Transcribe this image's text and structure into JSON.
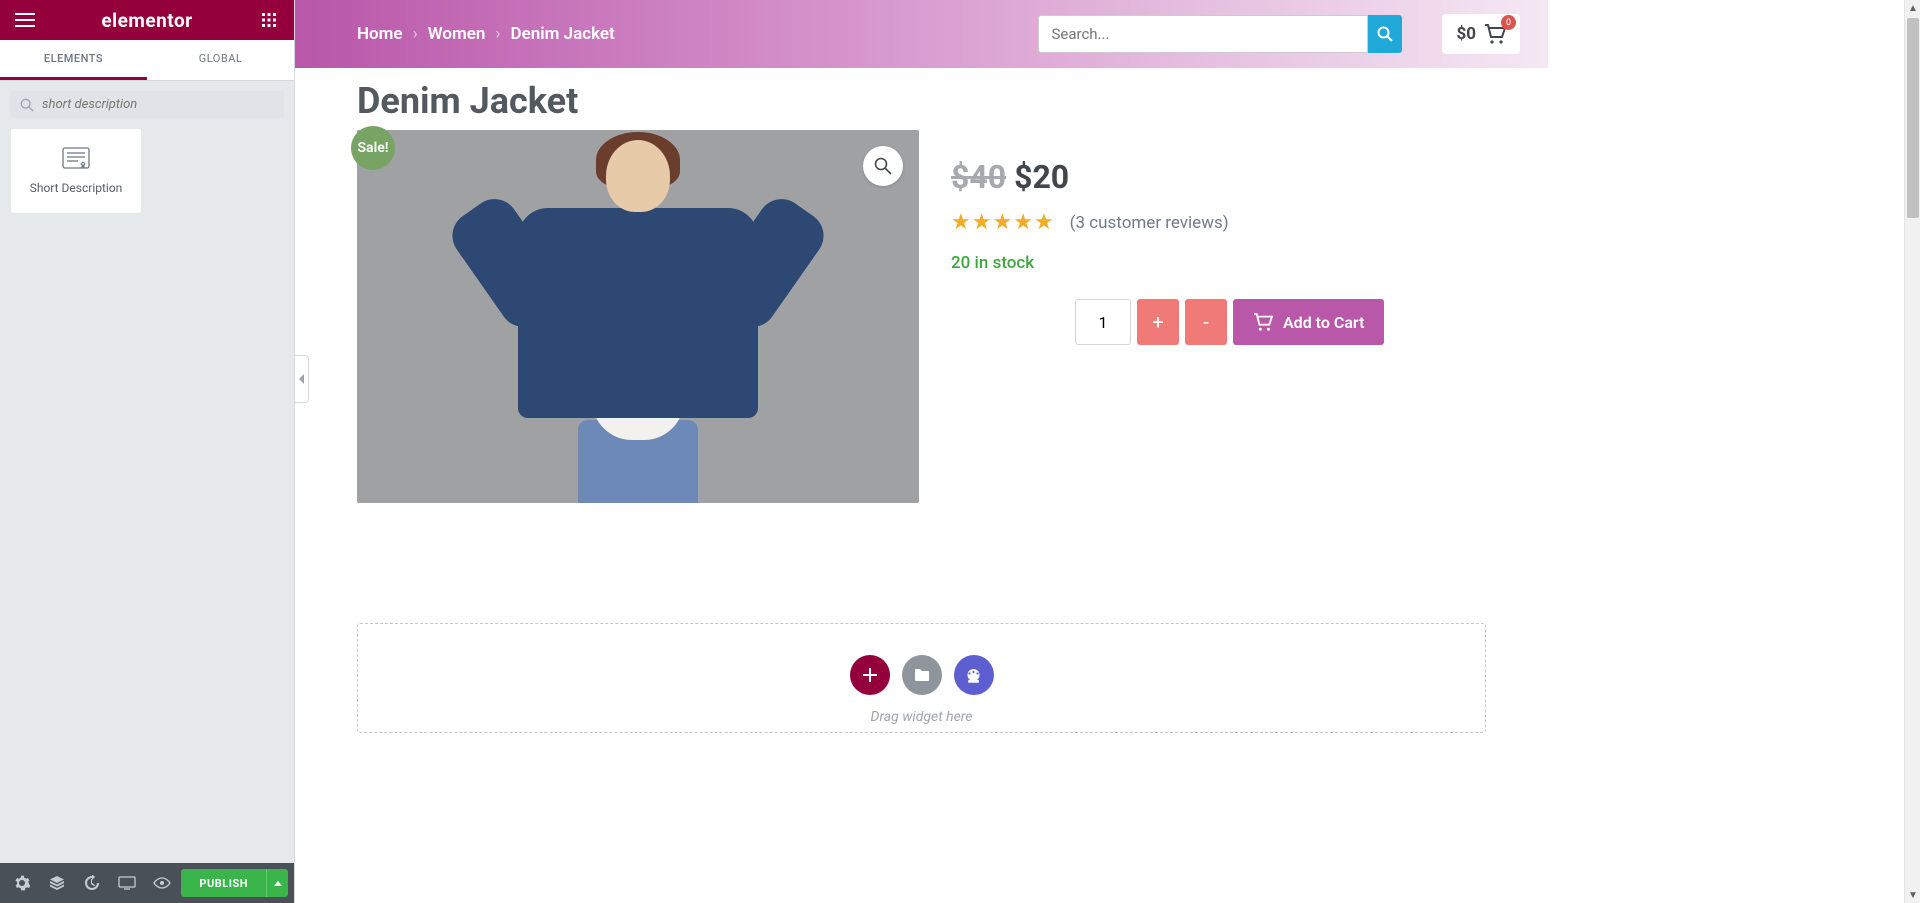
{
  "sidebar": {
    "logo": "elementor",
    "tabs": {
      "elements": "ELEMENTS",
      "global": "GLOBAL"
    },
    "search_placeholder": "short description",
    "widgets": [
      {
        "label": "Short Description"
      }
    ],
    "footer": {
      "publish": "PUBLISH"
    }
  },
  "topbar": {
    "breadcrumb": [
      "Home",
      "Women",
      "Denim Jacket"
    ],
    "search_placeholder": "Search...",
    "cart_total": "$0",
    "cart_count": "0"
  },
  "product": {
    "title": "Denim Jacket",
    "sale_label": "Sale!",
    "old_price": "$40",
    "new_price": "$20",
    "reviews_text": "(3 customer reviews)",
    "stock_text": "20 in stock",
    "qty": "1",
    "plus": "+",
    "minus": "-",
    "add_to_cart": "Add to Cart"
  },
  "dropzone": {
    "hint": "Drag widget here"
  }
}
